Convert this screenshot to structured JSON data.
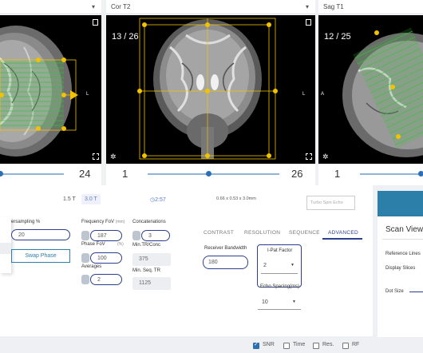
{
  "viewports": [
    {
      "title": "",
      "slice_index": "24",
      "slice_text": "",
      "right_dir": ""
    },
    {
      "title": "Cor T2",
      "slice_index": "26",
      "slice_text": "13 / 26",
      "start": "1",
      "right_dir": "L"
    },
    {
      "title": "Sag T1",
      "slice_index": "",
      "slice_text": "12 / 25",
      "start": "1",
      "left_dir": "A"
    }
  ],
  "left_dir_l": "L",
  "header": {
    "field_15": "1.5 T",
    "field_30": "3.0 T",
    "time": "2:57",
    "voxel": "0.66 x 0.53 x 3.0mm",
    "tse_button": "Turbo Spin Echo"
  },
  "params": {
    "oversampling_label": "ersampling %",
    "oversampling_value": "20",
    "swap_phase": "Swap Phase",
    "freq_fov_label": "Frequency FoV",
    "freq_fov_unit": "(mm)",
    "freq_fov_value": "187",
    "phase_fov_label": "Phase FoV",
    "phase_fov_unit": "(%)",
    "phase_fov_value": "100",
    "averages_label": "Averages",
    "averages_value": "2",
    "concat_label": "Concatenations",
    "concat_value": "3",
    "min_trconc_label": "Min.TR/Conc",
    "min_trconc_value": "375",
    "min_seqtr_label": "Min. Seq. TR",
    "min_seqtr_value": "1125"
  },
  "tabs": [
    "CONTRAST",
    "RESOLUTION",
    "SEQUENCE",
    "ADVANCED"
  ],
  "advanced": {
    "rb_label": "Receiver Bandwidth",
    "rb_value": "180",
    "ipat_label": "I-Pat Factor",
    "ipat_value": "2",
    "echo_label": "Echo Spacing(ms)",
    "echo_value": "10"
  },
  "right_panel": {
    "title": "Scan View",
    "ref_lines": "Reference Lines",
    "display_slices": "Display Slices",
    "dot_size": "Dot Size"
  },
  "checks": [
    {
      "label": "SNR",
      "checked": true
    },
    {
      "label": "Time",
      "checked": false
    },
    {
      "label": "Res.",
      "checked": false
    },
    {
      "label": "RF",
      "checked": false
    }
  ],
  "colors": {
    "accent": "#2d3f8f",
    "slider": "#2d6fb7",
    "scan_bar": "#2b7fa8",
    "overlay_green": "#3fbf3f",
    "overlay_yellow": "#f2c200"
  }
}
